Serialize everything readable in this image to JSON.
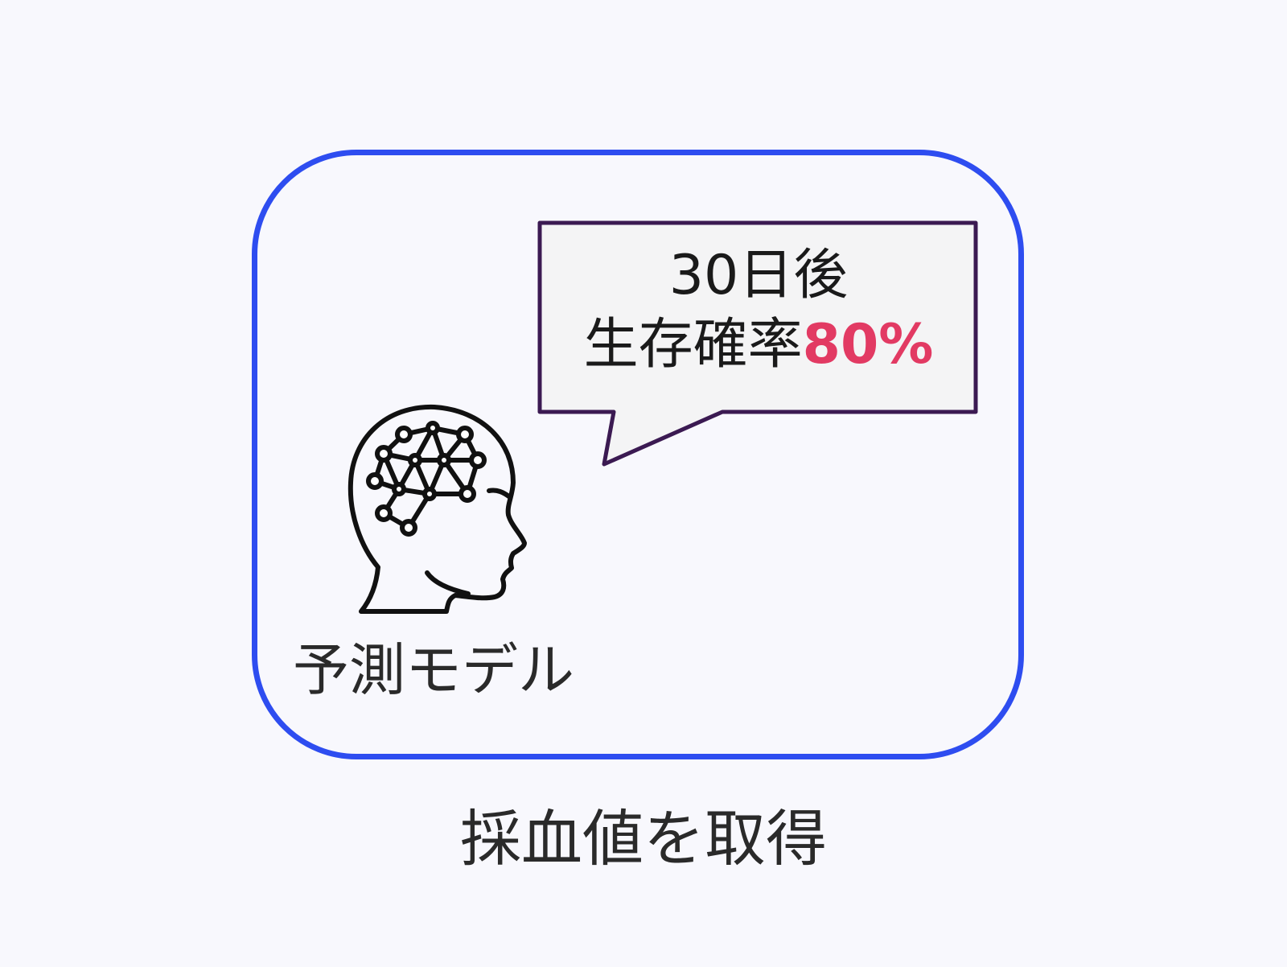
{
  "bubble": {
    "line1": "30日後",
    "line2_prefix": "生存確率",
    "line2_value": "80%",
    "fill_color": "#f4f4f5",
    "border_color": "#3b1a52",
    "value_color": "#e23a63"
  },
  "model": {
    "label": "予測モデル",
    "icon": "ai-head-brain-network-icon"
  },
  "caption": "採血値を取得",
  "colors": {
    "frame_border": "#2e4df0",
    "background": "#f8f8fd",
    "text": "#2a2a2a"
  }
}
